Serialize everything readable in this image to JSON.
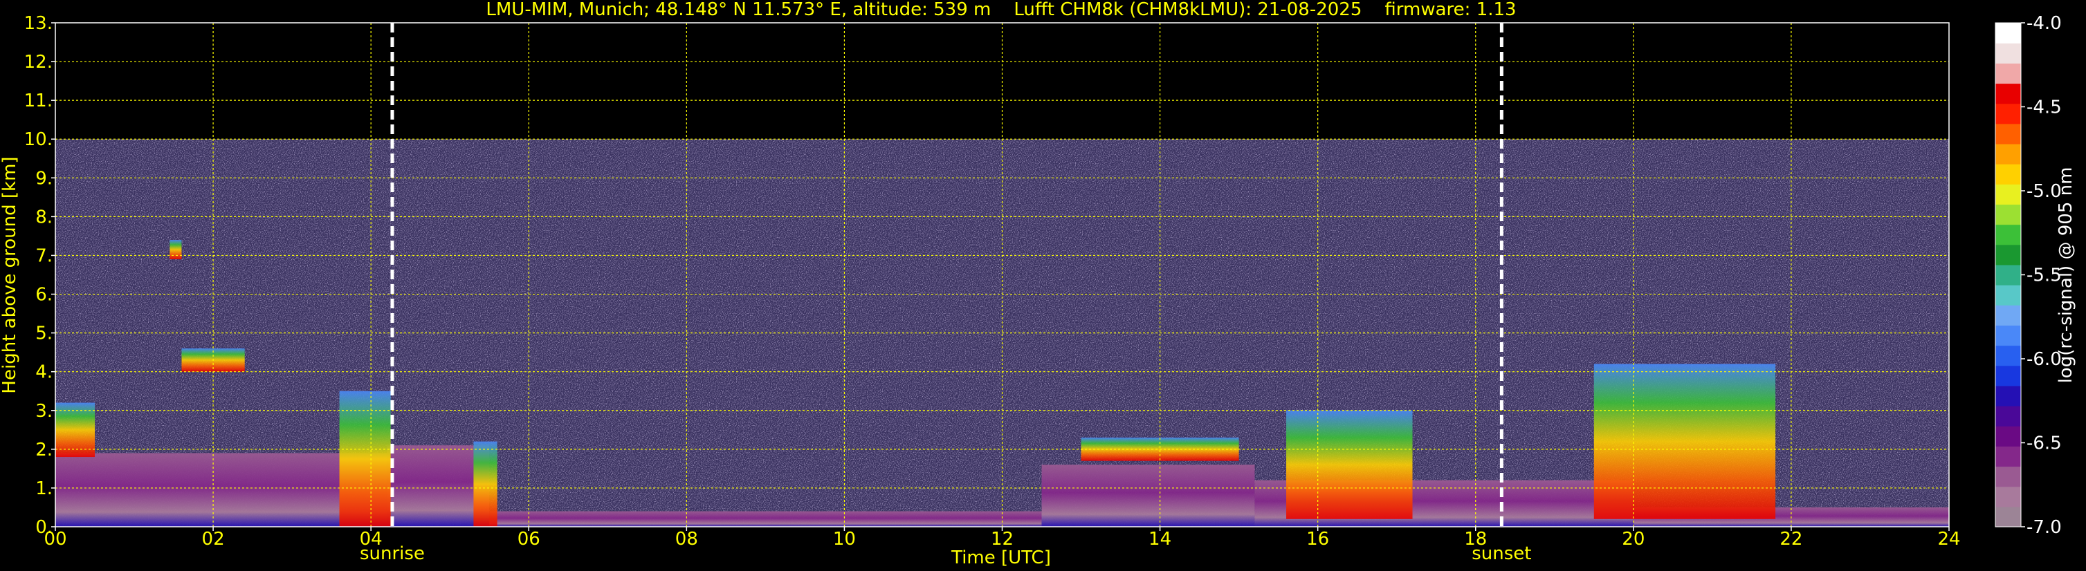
{
  "chart_data": {
    "type": "heatmap",
    "title": "LMU-MIM, Munich; 48.148° N 11.573° E, altitude: 539 m    Lufft CHM8k (CHM8kLMU): 21-08-2025    firmware: 1.13",
    "xlabel": "Time [UTC]",
    "ylabel": "Height above ground [km]",
    "xlim": [
      0,
      24
    ],
    "ylim": [
      0,
      13
    ],
    "x_ticks": [
      "00",
      "02",
      "04",
      "06",
      "08",
      "10",
      "12",
      "14",
      "16",
      "18",
      "20",
      "22",
      "24"
    ],
    "y_ticks": [
      "0.",
      "1.",
      "2.",
      "3.",
      "4.",
      "5.",
      "6.",
      "7.",
      "8.",
      "9.",
      "10.",
      "11.",
      "12.",
      "13."
    ],
    "grid": true,
    "signal_top_km": 10,
    "markers": [
      {
        "label": "sunrise",
        "time": 4.27
      },
      {
        "label": "sunset",
        "time": 18.33
      }
    ],
    "colorbar": {
      "label": "log(rc-signal) @ 905 nm",
      "range": [
        -7.0,
        -4.0
      ],
      "ticks": [
        "-4.0",
        "-4.5",
        "-5.0",
        "-5.5",
        "-6.0",
        "-6.5",
        "-7.0"
      ],
      "colors": [
        "#9c8496",
        "#a87a9c",
        "#9a5a92",
        "#84288a",
        "#6a0a84",
        "#4a0898",
        "#2410b4",
        "#1838e0",
        "#2860f0",
        "#4a88f8",
        "#70a8f4",
        "#58c8c8",
        "#30b088",
        "#1a9830",
        "#3cc038",
        "#9ce032",
        "#e8f020",
        "#ffd000",
        "#ffa000",
        "#ff6000",
        "#ff2000",
        "#e80000",
        "#f0a8a8",
        "#f0e0e0",
        "#ffffff"
      ]
    },
    "layers": [
      {
        "name": "boundary layer",
        "segments": [
          {
            "x": [
              0,
              4.2
            ],
            "top": 1.9,
            "bottom": 0.0
          },
          {
            "x": [
              4.2,
              5.5
            ],
            "top": 2.1,
            "bottom": 0.0
          },
          {
            "x": [
              5.5,
              12.5
            ],
            "top": 0.4,
            "bottom": 0.0
          },
          {
            "x": [
              12.5,
              15.2
            ],
            "top": 1.6,
            "bottom": 0.0
          },
          {
            "x": [
              15.2,
              20.0
            ],
            "top": 1.2,
            "bottom": 0.0
          },
          {
            "x": [
              20.0,
              24.0
            ],
            "top": 0.5,
            "bottom": 0.0
          }
        ]
      },
      {
        "name": "clouds",
        "segments": [
          {
            "x": [
              0.0,
              0.5
            ],
            "top": 3.2,
            "bottom": 1.8
          },
          {
            "x": [
              1.6,
              2.4
            ],
            "top": 4.6,
            "bottom": 4.0
          },
          {
            "x": [
              1.45,
              1.6
            ],
            "top": 7.4,
            "bottom": 6.9
          },
          {
            "x": [
              3.6,
              4.25
            ],
            "top": 3.5,
            "bottom": 0.0
          },
          {
            "x": [
              5.3,
              5.6
            ],
            "top": 2.2,
            "bottom": 0.0
          },
          {
            "x": [
              13.0,
              15.0
            ],
            "top": 2.3,
            "bottom": 1.7
          },
          {
            "x": [
              15.6,
              17.2
            ],
            "top": 3.0,
            "bottom": 0.2
          },
          {
            "x": [
              19.5,
              21.8
            ],
            "top": 4.2,
            "bottom": 0.2
          }
        ]
      }
    ]
  }
}
